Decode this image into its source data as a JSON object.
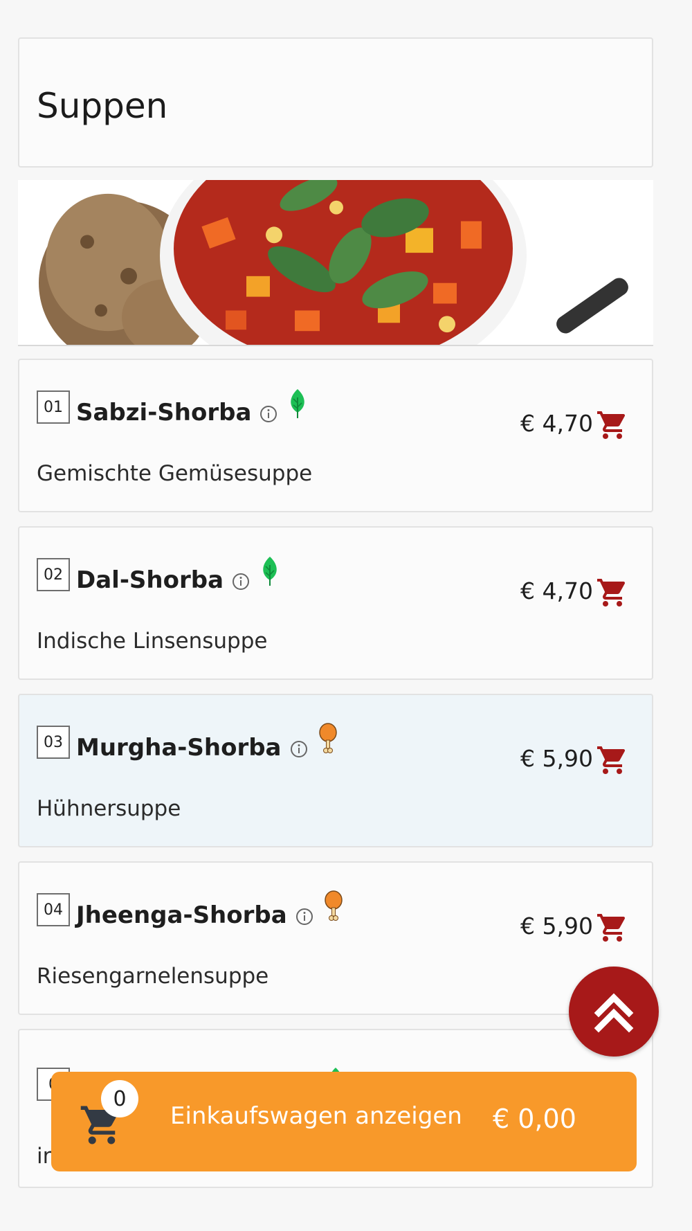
{
  "category": {
    "title": "Suppen"
  },
  "colors": {
    "accent_red": "#a71919",
    "cart_bar": "#f8992a",
    "active_item_bg": "#eef5f9",
    "veg_green": "#1dbf55",
    "meat_orange": "#f0892a"
  },
  "items": [
    {
      "number": "01",
      "name": "Sabzi-Shorba",
      "description": "Gemischte Gemüsesuppe",
      "price": "€ 4,70",
      "diet_icon": "leaf-icon"
    },
    {
      "number": "02",
      "name": "Dal-Shorba",
      "description": "Indische Linsensuppe",
      "price": "€ 4,70",
      "diet_icon": "leaf-icon"
    },
    {
      "number": "03",
      "name": "Murgha-Shorba",
      "description": "Hühnersuppe",
      "price": "€ 5,90",
      "diet_icon": "chicken-leg-icon"
    },
    {
      "number": "04",
      "name": "Jheenga-Shorba",
      "description": "Riesengarnelensuppe",
      "price": "€ 5,90",
      "diet_icon": "chicken-leg-icon"
    },
    {
      "number": "0",
      "description": "in"
    }
  ],
  "cart": {
    "count": "0",
    "label": "Einkaufswagen anzeigen",
    "total": "€ 0,00"
  }
}
